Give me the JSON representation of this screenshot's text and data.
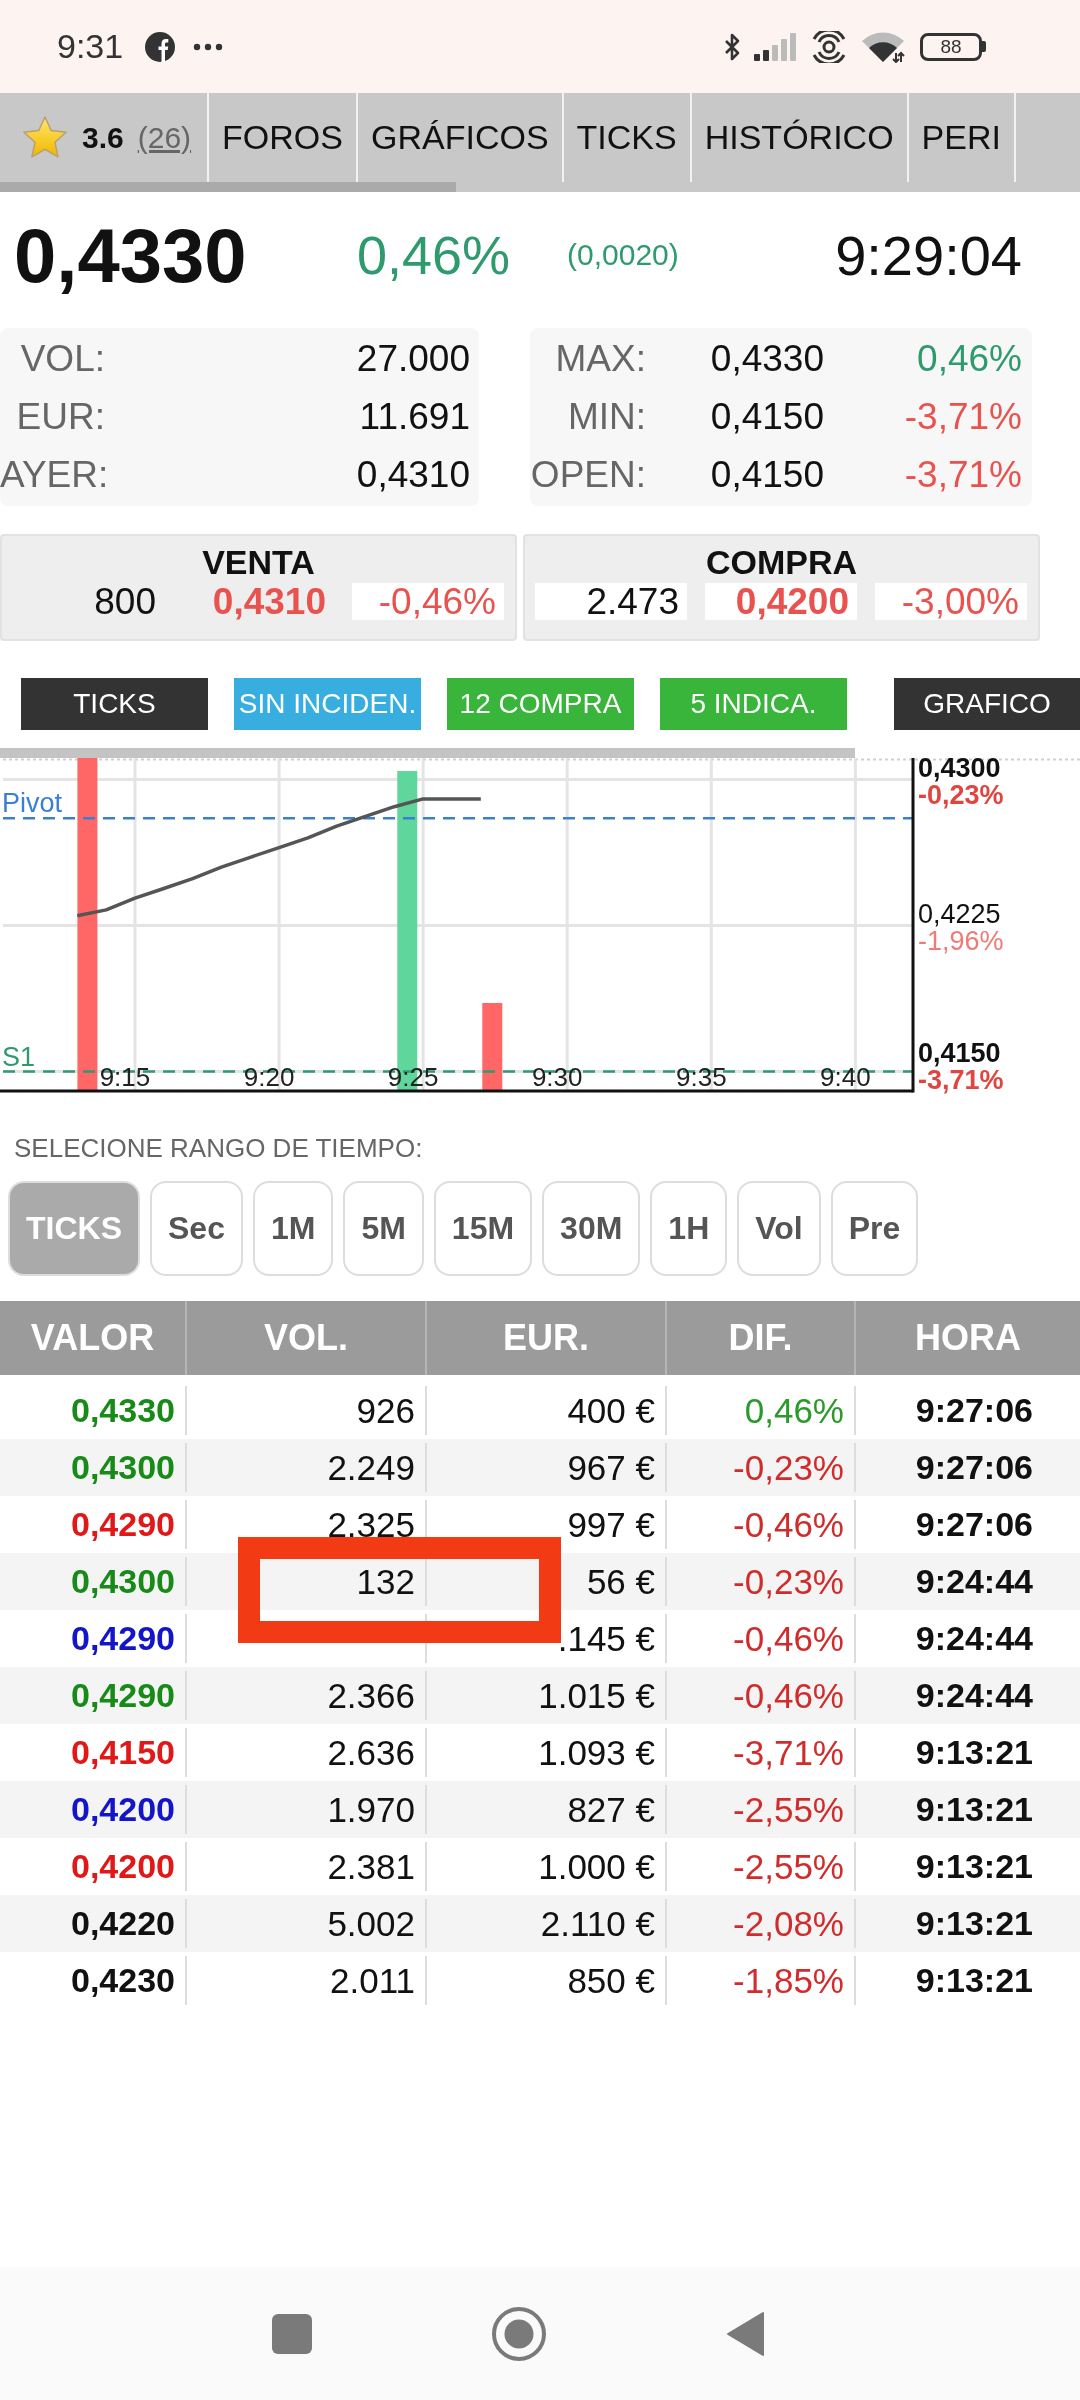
{
  "status_bar": {
    "time": "9:31",
    "battery": "88"
  },
  "tabs": [
    {
      "kind": "rating",
      "rating": "3.6",
      "count": "(26)"
    },
    {
      "kind": "label",
      "label": "FOROS"
    },
    {
      "kind": "label",
      "label": "GRÁFICOS"
    },
    {
      "kind": "label",
      "label": "TICKS"
    },
    {
      "kind": "label",
      "label": "HISTÓRICO"
    },
    {
      "kind": "label",
      "label": "PERI"
    }
  ],
  "quote": {
    "price": "0,4330",
    "change_percent": "0,46%",
    "change_amount": "(0,0020)",
    "rising": true,
    "time": "9:29:04"
  },
  "stats": {
    "left": [
      {
        "label": "VOL:",
        "value": "27.000"
      },
      {
        "label": "EUR:",
        "value": "11.691"
      },
      {
        "label": "AYER:",
        "value": "0,4310"
      }
    ],
    "right": [
      {
        "label": "MAX:",
        "value": "0,4330",
        "change": "0,46%",
        "color": "#2e9a6e"
      },
      {
        "label": "MIN:",
        "value": "0,4150",
        "change": "-3,71%",
        "color": "#e8534f"
      },
      {
        "label": "OPEN:",
        "value": "0,4150",
        "change": "-3,71%",
        "color": "#e8534f"
      }
    ]
  },
  "order_book": [
    {
      "title": "VENTA",
      "cells": [
        {
          "kind": "quantity",
          "text": "800",
          "highlight": false
        },
        {
          "kind": "price",
          "text": "0,4310",
          "highlight": false
        },
        {
          "kind": "change",
          "text": "-0,46%",
          "highlight": true
        }
      ]
    },
    {
      "title": "COMPRA",
      "cells": [
        {
          "kind": "quantity",
          "text": "2.473",
          "highlight": true
        },
        {
          "kind": "price",
          "text": "0,4200",
          "highlight": true
        },
        {
          "kind": "change",
          "text": "-3,00%",
          "highlight": true
        }
      ]
    }
  ],
  "indicator_buttons": [
    {
      "label": "TICKS",
      "kind": "dark"
    },
    {
      "label": "SIN INCIDEN.",
      "kind": "info"
    },
    {
      "label": "12 COMPRA",
      "kind": "buy"
    },
    {
      "label": "5 INDICA.",
      "kind": "buy"
    },
    {
      "label": "GRAFICO",
      "kind": "dark"
    }
  ],
  "chart": {
    "percent_labels": [
      "-0,23%",
      "-1,96%",
      "-3,71%"
    ],
    "chart_data": {
      "type": "line",
      "grid": true,
      "categories": [
        null,
        null,
        null,
        null,
        "9:15",
        null,
        null,
        null,
        null,
        "9:20",
        null,
        null,
        null,
        null,
        "9:25",
        null,
        null,
        null,
        null,
        "9:30",
        null,
        null,
        null,
        null,
        "9:35",
        null,
        null,
        null,
        null,
        "9:40",
        null,
        null
      ],
      "series": [
        {
          "color": "#555555",
          "values": [
            null,
            null,
            0.423,
            0.4233,
            0.4239,
            0.4244,
            0.4249,
            0.4255,
            0.426,
            0.4265,
            0.427,
            0.4276,
            0.4281,
            0.4286,
            0.429,
            0.429,
            0.429,
            null,
            null,
            null,
            null,
            null,
            null,
            null,
            null,
            null,
            null,
            null,
            null,
            null,
            null,
            null
          ]
        }
      ],
      "ylim": [
        0.414,
        0.4311
      ],
      "yticks": [
        {
          "value": 0.43,
          "label": "0,4300"
        },
        {
          "value": 0.4225,
          "label": "0,4225"
        },
        {
          "value": 0.415,
          "label": "0,4150"
        }
      ],
      "ref_lines": [
        {
          "axis": "y",
          "value": 0.428,
          "label": "Pivot",
          "color": "#3a7fd6"
        },
        {
          "axis": "y",
          "value": 0.415,
          "label": "S1",
          "color": "#2e9a6e"
        }
      ]
    }
  },
  "time_range": {
    "label": "SELECIONE RANGO DE TIEMPO:",
    "options": [
      {
        "label": "TICKS",
        "selected": true
      },
      {
        "label": "Sec",
        "selected": false
      },
      {
        "label": "1M",
        "selected": false
      },
      {
        "label": "5M",
        "selected": false
      },
      {
        "label": "15M",
        "selected": false
      },
      {
        "label": "30M",
        "selected": false
      },
      {
        "label": "1H",
        "selected": false
      },
      {
        "label": "Vol",
        "selected": false
      },
      {
        "label": "Pre",
        "selected": false
      }
    ]
  },
  "table": {
    "columns": [
      "VALOR",
      "VOL.",
      "EUR.",
      "DIF.",
      "HORA"
    ],
    "rows": [
      {
        "valor": {
          "text": "0,4330",
          "color": "#178a17"
        },
        "vol": "926",
        "eur": "400 €",
        "dif": {
          "text": "0,46%",
          "color": "#2a9a2a"
        },
        "hora": "9:27:06",
        "marked": false
      },
      {
        "valor": {
          "text": "0,4300",
          "color": "#178a17"
        },
        "vol": "2.249",
        "eur": "967 €",
        "dif": {
          "text": "-0,23%",
          "color": "#d02c2c"
        },
        "hora": "9:27:06",
        "marked": false
      },
      {
        "valor": {
          "text": "0,4290",
          "color": "#e01818"
        },
        "vol": "2.325",
        "eur": "997 €",
        "dif": {
          "text": "-0,46%",
          "color": "#d02c2c"
        },
        "hora": "9:27:06",
        "marked": false
      },
      {
        "valor": {
          "text": "0,4300",
          "color": "#178a17"
        },
        "vol": "132",
        "eur": "56 €",
        "dif": {
          "text": "-0,23%",
          "color": "#d02c2c"
        },
        "hora": "9:24:44",
        "marked": true
      },
      {
        "valor": {
          "text": "0,4290",
          "color": "#1414c8"
        },
        "eur": ".145 €",
        "dif": {
          "text": "-0,46%",
          "color": "#d02c2c"
        },
        "hora": "9:24:44",
        "marked": false
      },
      {
        "valor": {
          "text": "0,4290",
          "color": "#178a17"
        },
        "vol": "2.366",
        "eur": "1.015 €",
        "dif": {
          "text": "-0,46%",
          "color": "#d02c2c"
        },
        "hora": "9:24:44",
        "marked": false
      },
      {
        "valor": {
          "text": "0,4150",
          "color": "#e01818"
        },
        "vol": "2.636",
        "eur": "1.093 €",
        "dif": {
          "text": "-3,71%",
          "color": "#d02c2c"
        },
        "hora": "9:13:21",
        "marked": false
      },
      {
        "valor": {
          "text": "0,4200",
          "color": "#1414c8"
        },
        "vol": "1.970",
        "eur": "827 €",
        "dif": {
          "text": "-2,55%",
          "color": "#d02c2c"
        },
        "hora": "9:13:21",
        "marked": false
      },
      {
        "valor": {
          "text": "0,4200",
          "color": "#e01818"
        },
        "vol": "2.381",
        "eur": "1.000 €",
        "dif": {
          "text": "-2,55%",
          "color": "#d02c2c"
        },
        "hora": "9:13:21",
        "marked": false
      },
      {
        "valor": {
          "text": "0,4220",
          "color": "#111111"
        },
        "vol": "5.002",
        "eur": "2.110 €",
        "dif": {
          "text": "-2,08%",
          "color": "#d02c2c"
        },
        "hora": "9:13:21",
        "marked": false
      },
      {
        "valor": {
          "text": "0,4230",
          "color": "#111111"
        },
        "vol": "2.011",
        "eur": "850 €",
        "dif": {
          "text": "-1,85%",
          "color": "#d02c2c"
        },
        "hora": "9:13:21",
        "marked": false
      }
    ]
  }
}
